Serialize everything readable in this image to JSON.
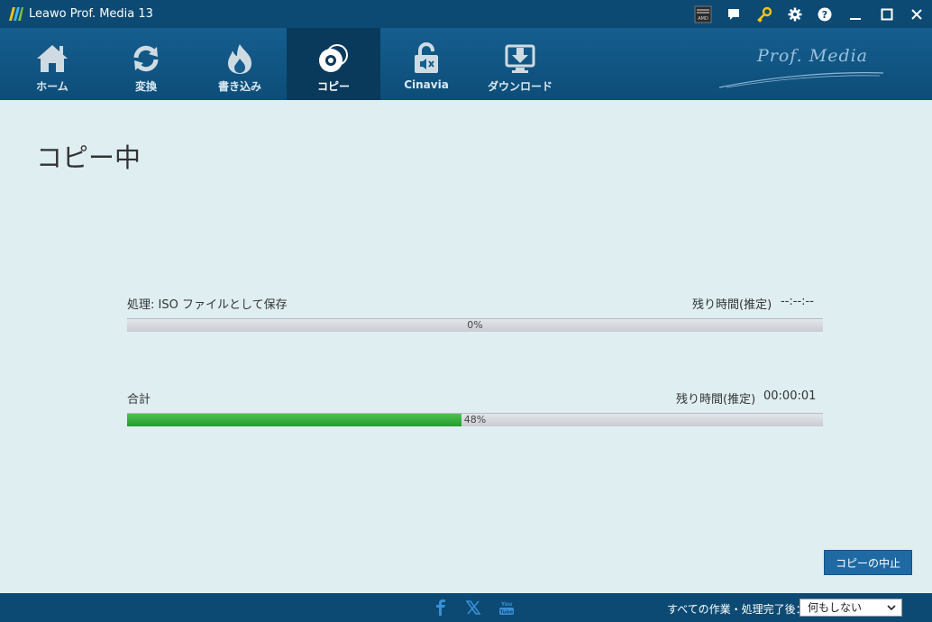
{
  "app": {
    "title": "Leawo Prof. Media 13"
  },
  "titlebar_icons": [
    "amd-icon",
    "feedback-icon",
    "key-icon",
    "gear-icon",
    "help-icon",
    "minimize-icon",
    "maximize-icon",
    "close-icon"
  ],
  "nav": {
    "items": [
      {
        "label": "ホーム",
        "icon": "home-icon"
      },
      {
        "label": "変換",
        "icon": "convert-icon"
      },
      {
        "label": "書き込み",
        "icon": "burn-icon"
      },
      {
        "label": "コピー",
        "icon": "copy-icon",
        "active": true
      },
      {
        "label": "Cinavia",
        "icon": "cinavia-icon"
      },
      {
        "label": "ダウンロード",
        "icon": "download-icon"
      }
    ],
    "brand": "Prof. Media"
  },
  "page": {
    "title": "コピー中"
  },
  "task": {
    "label": "処理: ISO ファイルとして保存",
    "remaining_label": "残り時間(推定)",
    "remaining_value": "--:--:--",
    "progress": 0,
    "progress_text": "0%"
  },
  "total": {
    "label": "合計",
    "remaining_label": "残り時間(推定)",
    "remaining_value": "00:00:01",
    "progress": 0.48,
    "progress_text": "48%"
  },
  "buttons": {
    "stop_copy": "コピーの中止"
  },
  "footer": {
    "after_label": "すべての作業・処理完了後：",
    "after_value": "何もしない",
    "social": [
      "facebook-icon",
      "x-icon",
      "youtube-icon"
    ]
  },
  "colors": {
    "titlebar": "#0c4a73",
    "nav_active": "#093a5c",
    "progress_fill": "#2fae38",
    "button": "#1f6aa3",
    "background": "#dfeef1"
  }
}
